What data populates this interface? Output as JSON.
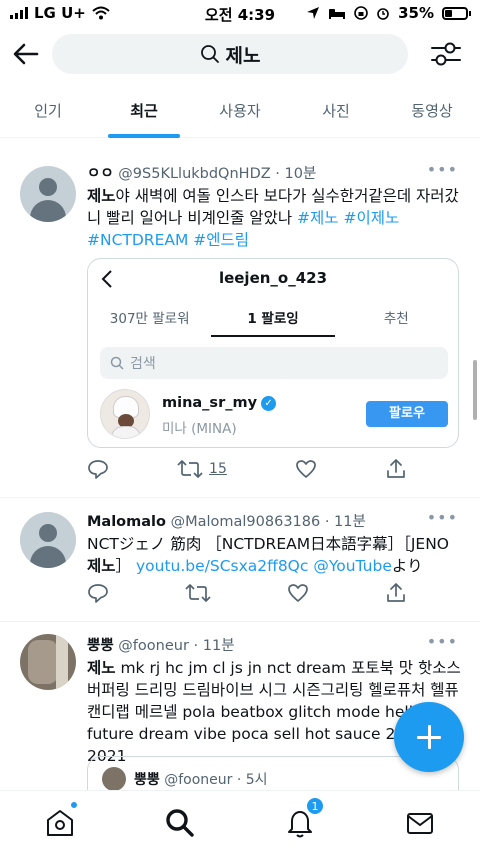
{
  "status_bar": {
    "carrier": "LG U+",
    "time": "오전 4:39",
    "battery": "35%"
  },
  "search": {
    "query": "제노"
  },
  "tabs": [
    {
      "label": "인기",
      "active": false
    },
    {
      "label": "최근",
      "active": true
    },
    {
      "label": "사용자",
      "active": false
    },
    {
      "label": "사진",
      "active": false
    },
    {
      "label": "동영상",
      "active": false
    }
  ],
  "tweets": [
    {
      "display_name": "ㅇㅇ",
      "handle": "@9S5KLlukbdQnHDZ",
      "time": "· 10분",
      "text_bold": "제노",
      "text": "야 새벽에 여돌 인스타 보다가 실수한거같은데 자러갔니 빨리 일어나 비계인줄 알았나 ",
      "hashtags": "#제노 #이제노 #NCTDREAM #엔드림",
      "retweets": "15",
      "card": {
        "username": "leejen_o_423",
        "tabs": [
          "307만 팔로워",
          "1 팔로잉",
          "추천"
        ],
        "search_placeholder": "검색",
        "user": {
          "username": "mina_sr_my",
          "display": "미나 (MINA)",
          "follow_label": "팔로우"
        }
      }
    },
    {
      "display_name": "Malomalo",
      "handle": "@Malomal90863186",
      "time": "· 11분",
      "text_line1": "NCTジェノ 筋肉 ［NCTDREAM日本語字幕］［JENO",
      "text_bold": "제노",
      "text_rest": "］ ",
      "link": "youtu.be/SCsxa2ff8Qc",
      "mention": "@YouTube",
      "suffix": "より"
    },
    {
      "display_name": "뿡뿡",
      "handle": "@fooneur",
      "time": "· 11분",
      "text_bold": "제노",
      "text": " mk rj hc jm cl js jn nct dream 포토북 맛 핫소스 버퍼링 드리밍 드림바이브 시그 시즌그리팅 헬로퓨처 헬퓨 캔디랩 메르넬 pola beatbox glitch mode hello future dream vibe poca sell hot sauce 2020 2021",
      "quoted": {
        "display_name": "뿡뿡",
        "handle": "@fooneur",
        "time": "· 5시"
      }
    }
  ],
  "bottom_nav": {
    "notifications_badge": "1"
  },
  "colors": {
    "accent": "#1d9bf0",
    "muted": "#536471"
  }
}
